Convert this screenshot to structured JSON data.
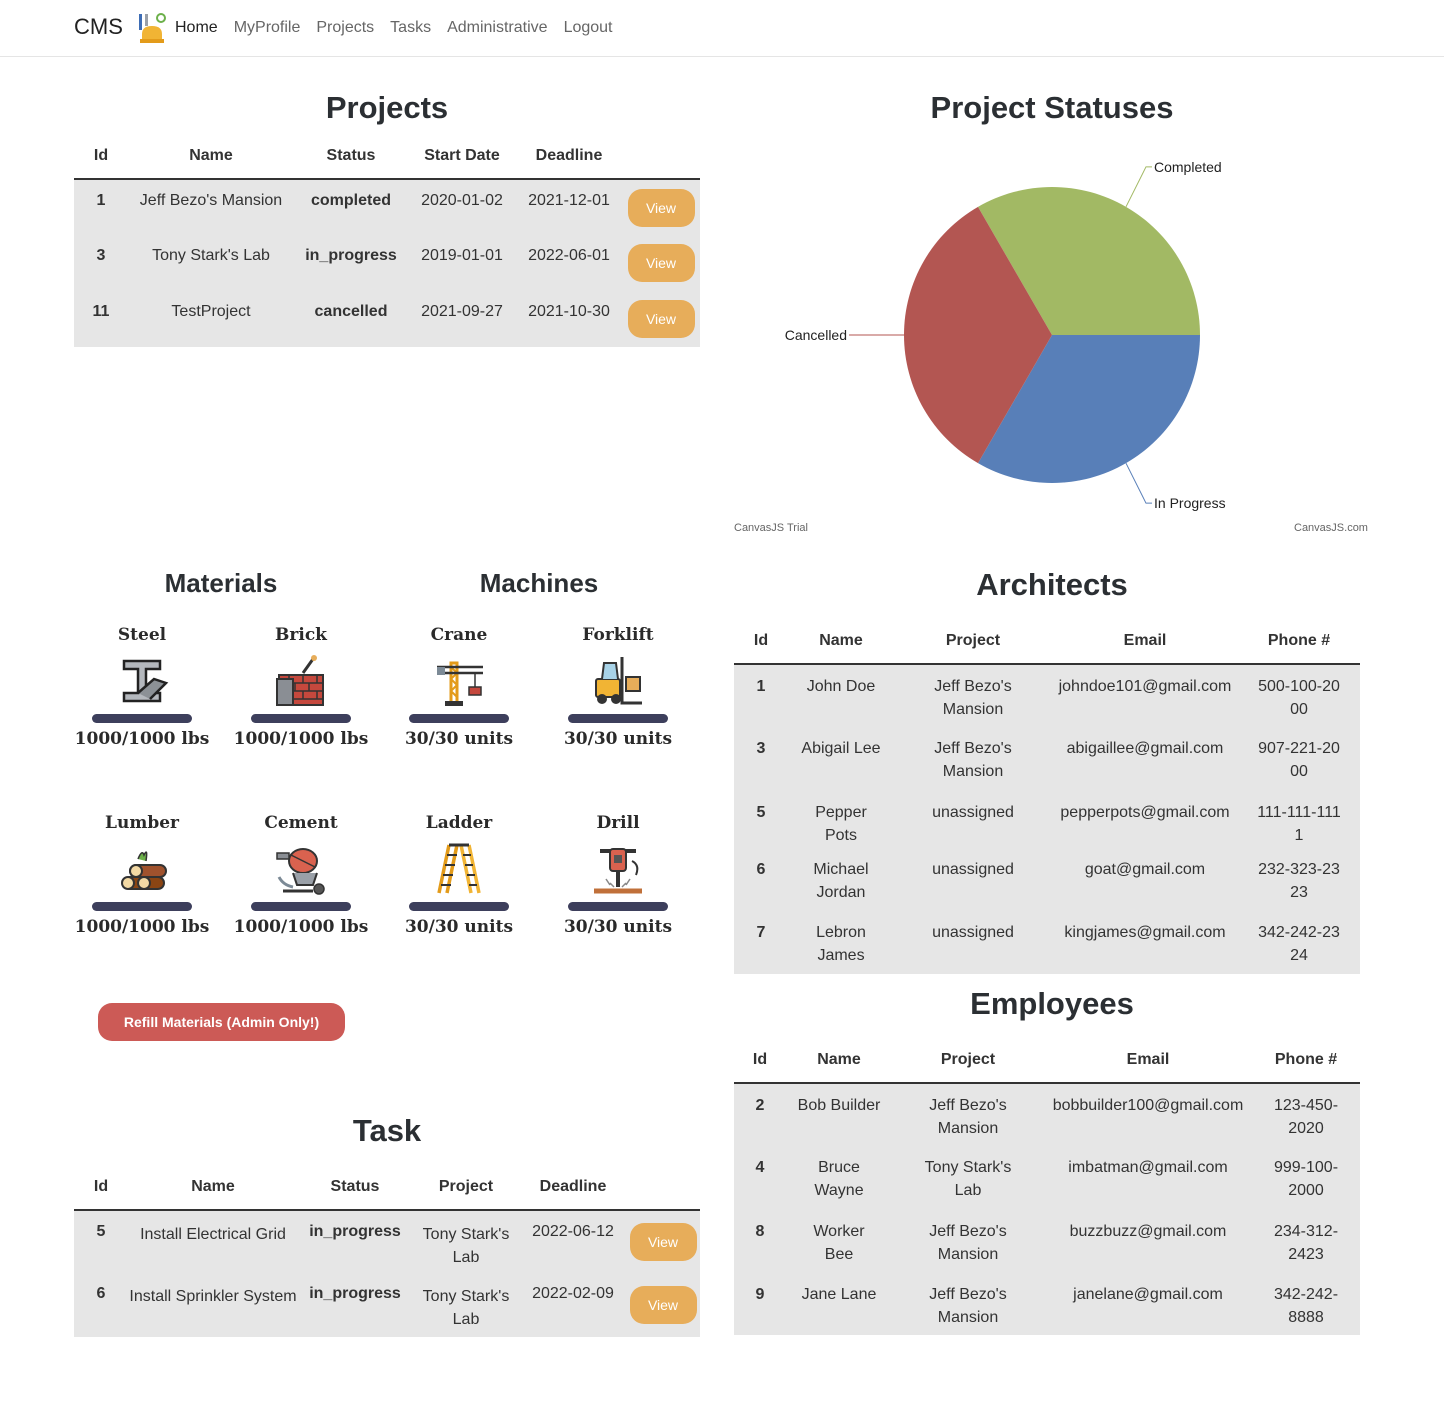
{
  "nav": {
    "brand": "CMS",
    "links": [
      "Home",
      "MyProfile",
      "Projects",
      "Tasks",
      "Administrative",
      "Logout"
    ]
  },
  "projects": {
    "title": "Projects",
    "headers": [
      "Id",
      "Name",
      "Status",
      "Start Date",
      "Deadline"
    ],
    "rows": [
      {
        "id": "1",
        "name": "Jeff Bezo's Mansion",
        "status": "completed",
        "start": "2020-01-02",
        "deadline": "2021-12-01",
        "action": "View"
      },
      {
        "id": "3",
        "name": "Tony Stark's Lab",
        "status": "in_progress",
        "start": "2019-01-01",
        "deadline": "2022-06-01",
        "action": "View"
      },
      {
        "id": "11",
        "name": "TestProject",
        "status": "cancelled",
        "start": "2021-09-27",
        "deadline": "2021-10-30",
        "action": "View"
      }
    ]
  },
  "statuses_chart": {
    "title": "Project Statuses",
    "watermark_left": "CanvasJS Trial",
    "watermark_right": "CanvasJS.com"
  },
  "chart_data": {
    "type": "pie",
    "title": "Project Statuses",
    "slices": [
      {
        "label": "Completed",
        "value": 1,
        "color": "#a2b964"
      },
      {
        "label": "In Progress",
        "value": 1,
        "color": "#587fb8"
      },
      {
        "label": "Cancelled",
        "value": 1,
        "color": "#b35652"
      }
    ]
  },
  "materials": {
    "title": "Materials",
    "items": [
      {
        "name": "Steel",
        "amount": "1000/1000 lbs",
        "icon": "steel-beam-icon",
        "fill": 1.0
      },
      {
        "name": "Brick",
        "amount": "1000/1000 lbs",
        "icon": "brick-wall-icon",
        "fill": 1.0
      },
      {
        "name": "Lumber",
        "amount": "1000/1000 lbs",
        "icon": "lumber-logs-icon",
        "fill": 1.0
      },
      {
        "name": "Cement",
        "amount": "1000/1000 lbs",
        "icon": "cement-mixer-icon",
        "fill": 1.0
      }
    ]
  },
  "machines": {
    "title": "Machines",
    "items": [
      {
        "name": "Crane",
        "amount": "30/30 units",
        "icon": "crane-icon",
        "fill": 1.0
      },
      {
        "name": "Forklift",
        "amount": "30/30 units",
        "icon": "forklift-icon",
        "fill": 1.0
      },
      {
        "name": "Ladder",
        "amount": "30/30 units",
        "icon": "ladder-icon",
        "fill": 1.0
      },
      {
        "name": "Drill",
        "amount": "30/30 units",
        "icon": "jackhammer-drill-icon",
        "fill": 1.0
      }
    ]
  },
  "refill_label": "Refill Materials (Admin Only!)",
  "tasks": {
    "title": "Task",
    "headers": [
      "Id",
      "Name",
      "Status",
      "Project",
      "Deadline"
    ],
    "rows": [
      {
        "id": "5",
        "name": "Install Electrical Grid",
        "status": "in_progress",
        "project": "Tony Stark's Lab",
        "deadline": "2022-06-12",
        "action": "View"
      },
      {
        "id": "6",
        "name": "Install Sprinkler System",
        "status": "in_progress",
        "project": "Tony Stark's Lab",
        "deadline": "2022-02-09",
        "action": "View"
      }
    ]
  },
  "architects": {
    "title": "Architects",
    "headers": [
      "Id",
      "Name",
      "Project",
      "Email",
      "Phone #"
    ],
    "rows": [
      {
        "id": "1",
        "name": "John Doe",
        "project": "Jeff Bezo's Mansion",
        "email": "johndoe101@gmail.com",
        "phone": "500-100-2000"
      },
      {
        "id": "3",
        "name": "Abigail Lee",
        "project": "Jeff Bezo's Mansion",
        "email": "abigaillee@gmail.com",
        "phone": "907-221-2000"
      },
      {
        "id": "5",
        "name": "Pepper Pots",
        "project": "unassigned",
        "email": "pepperpots@gmail.com",
        "phone": "111-111-1111"
      },
      {
        "id": "6",
        "name": "Michael Jordan",
        "project": "unassigned",
        "email": "goat@gmail.com",
        "phone": "232-323-2323"
      },
      {
        "id": "7",
        "name": "Lebron James",
        "project": "unassigned",
        "email": "kingjames@gmail.com",
        "phone": "342-242-2324"
      }
    ]
  },
  "employees": {
    "title": "Employees",
    "headers": [
      "Id",
      "Name",
      "Project",
      "Email",
      "Phone #"
    ],
    "rows": [
      {
        "id": "2",
        "name": "Bob Builder",
        "project": "Jeff Bezo's Mansion",
        "email": "bobbuilder100@gmail.com",
        "phone": "123-450-2020"
      },
      {
        "id": "4",
        "name": "Bruce Wayne",
        "project": "Tony Stark's Lab",
        "email": "imbatman@gmail.com",
        "phone": "999-100-2000"
      },
      {
        "id": "8",
        "name": "Worker Bee",
        "project": "Jeff Bezo's Mansion",
        "email": "buzzbuzz@gmail.com",
        "phone": "234-312-2423"
      },
      {
        "id": "9",
        "name": "Jane Lane",
        "project": "Jeff Bezo's Mansion",
        "email": "janelane@gmail.com",
        "phone": "342-242-8888"
      }
    ]
  }
}
